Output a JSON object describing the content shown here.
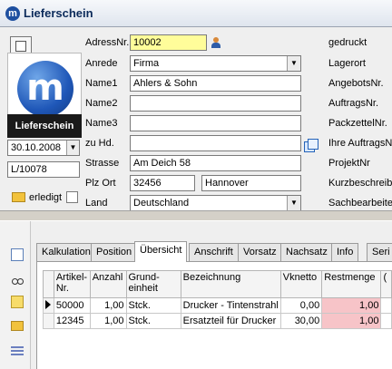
{
  "window": {
    "title": "Lieferschein"
  },
  "header": {
    "doc_type_label": "Lieferschein",
    "date": "30.10.2008",
    "doc_number": "L/10078",
    "erledigt_label": "erledigt"
  },
  "form": {
    "adressnr_label": "AdressNr.",
    "adressnr_value": "10002",
    "anrede_label": "Anrede",
    "anrede_value": "Firma",
    "name1_label": "Name1",
    "name1_value": "Ahlers & Sohn",
    "name2_label": "Name2",
    "name2_value": "",
    "name3_label": "Name3",
    "name3_value": "",
    "zuhd_label": "zu Hd.",
    "zuhd_value": "",
    "strasse_label": "Strasse",
    "strasse_value": "Am Deich 58",
    "plz_ort_label": "Plz  Ort",
    "plz_value": "32456",
    "ort_value": "Hannover",
    "land_label": "Land",
    "land_value": "Deutschland"
  },
  "right_labels": [
    "gedruckt",
    "Lagerort",
    "AngebotsNr.",
    "AuftragsNr.",
    "PackzettelNr.",
    "Ihre AuftragsN",
    "ProjektNr",
    "Kurzbeschreib",
    "Sachbearbeite"
  ],
  "tabs": [
    "Kalkulation",
    "Position",
    "Übersicht",
    "Anschrift",
    "Vorsatz",
    "Nachsatz",
    "Info",
    "Seri"
  ],
  "active_tab": "Übersicht",
  "table": {
    "headers": [
      "Artikel-\nNr.",
      "Anzahl",
      "Grund-\neinheit",
      "Bezeichnung",
      "Vknetto",
      "Restmenge",
      "("
    ],
    "rows": [
      [
        "50000",
        "1,00",
        "Stck.",
        "Drucker - Tintenstrahl",
        "0,00",
        "1,00"
      ],
      [
        "12345",
        "1,00",
        "Stck.",
        "Ersatzteil für Drucker",
        "30,00",
        "1,00"
      ]
    ]
  },
  "colors": {
    "adressnr_highlight": "#fffd9a",
    "restmenge_highlight": "#f7c4c8"
  }
}
